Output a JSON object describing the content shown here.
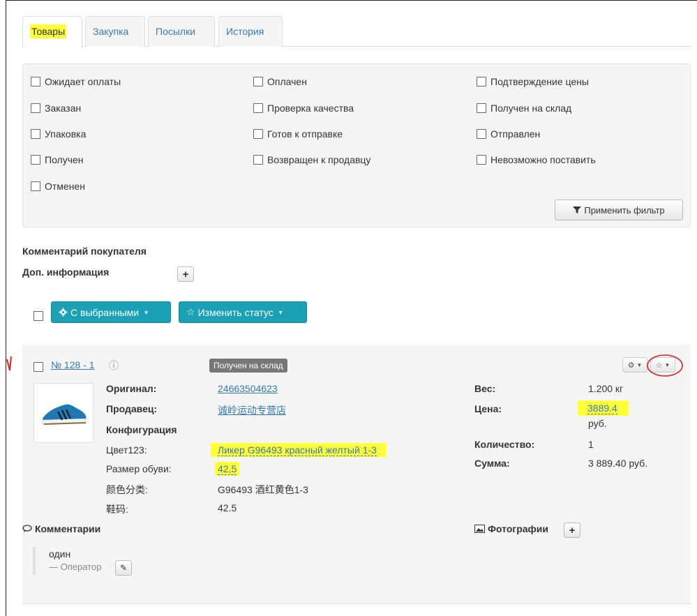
{
  "tabs": [
    {
      "label": "Товары",
      "active": true
    },
    {
      "label": "Закупка",
      "active": false
    },
    {
      "label": "Посылки",
      "active": false
    },
    {
      "label": "История",
      "active": false
    }
  ],
  "filters": {
    "col1": [
      "Ожидает оплаты",
      "Заказан",
      "Упаковка",
      "Получен",
      "Отменен"
    ],
    "col2": [
      "Оплачен",
      "Проверка качества",
      "Готов к отправке",
      "Возвращен к продавцу"
    ],
    "col3": [
      "Подтверждение цены",
      "Получен на склад",
      "Отправлен",
      "Невозможно поставить"
    ],
    "apply_label": "Применить фильтр"
  },
  "buyer_comment_label": "Комментарий покупателя",
  "extra_info_label": "Доп. информация",
  "actions": {
    "with_selected": "С выбранными",
    "change_status": "Изменить статус"
  },
  "order": {
    "number": "№ 128 - 1",
    "status": "Получен на склад",
    "original_label": "Оригинал:",
    "original_value": "24663504623",
    "seller_label": "Продавец:",
    "seller_value": "诚岭运动专营店",
    "config_label": "Конфигурация",
    "color_label": "Цвет123:",
    "color_value": "Ликер G96493 красный желтый 1-3",
    "size_label": "Размер обуви:",
    "size_value": "42,5",
    "cn_color_label": "颜色分类:",
    "cn_color_value": "G96493 酒红黄色1-3",
    "cn_size_label": "鞋码:",
    "cn_size_value": "42.5",
    "weight_label": "Вес:",
    "weight_value": "1.200 кг",
    "price_label": "Цена:",
    "price_value": "3889.4",
    "price_currency": "руб.",
    "qty_label": "Количество:",
    "qty_value": "1",
    "sum_label": "Сумма:",
    "sum_value": "3 889.40 руб.",
    "comments_label": "Комментарии",
    "comment_text": "один",
    "comment_author": "— Оператор",
    "photos_label": "Фотографии"
  },
  "colors": {
    "highlight": "#ffff3a",
    "teal": "#1aa1b5",
    "link": "#337ab7",
    "annotation_red": "#e02020"
  }
}
